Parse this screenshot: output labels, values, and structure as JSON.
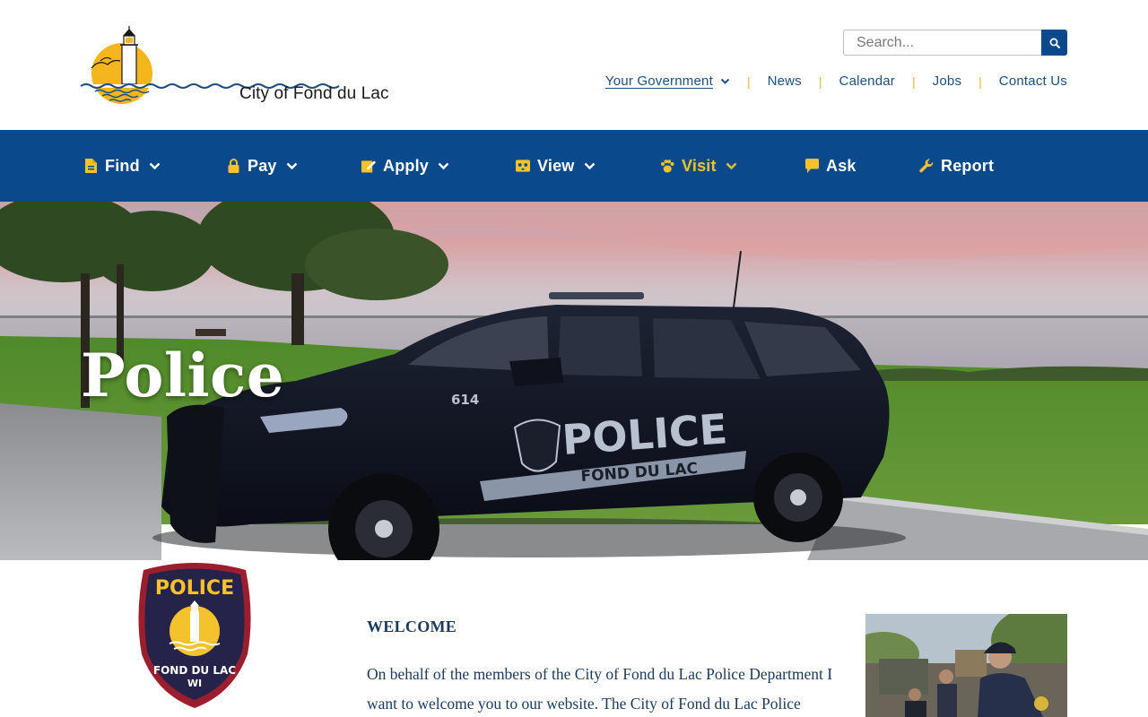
{
  "site": {
    "logo_text": "City of Fond du Lac"
  },
  "search": {
    "placeholder": "Search..."
  },
  "utility_nav": {
    "items": [
      {
        "label": "Your Government",
        "has_dropdown": true
      },
      {
        "label": "News"
      },
      {
        "label": "Calendar"
      },
      {
        "label": "Jobs"
      },
      {
        "label": "Contact Us"
      }
    ]
  },
  "main_nav": {
    "items": [
      {
        "label": "Find",
        "icon": "document-icon",
        "has_dropdown": true
      },
      {
        "label": "Pay",
        "icon": "lock-icon",
        "has_dropdown": true
      },
      {
        "label": "Apply",
        "icon": "edit-icon",
        "has_dropdown": true
      },
      {
        "label": "View",
        "icon": "viewer-icon",
        "has_dropdown": true
      },
      {
        "label": "Visit",
        "icon": "paw-icon",
        "has_dropdown": true,
        "active": true
      },
      {
        "label": "Ask",
        "icon": "speech-bubble-icon",
        "has_dropdown": false
      },
      {
        "label": "Report",
        "icon": "wrench-icon",
        "has_dropdown": false
      }
    ]
  },
  "hero": {
    "title": "Police",
    "car_number": "614",
    "car_text_main": "POLICE",
    "car_text_sub": "FOND DU LAC"
  },
  "badge": {
    "top_text": "POLICE",
    "bottom_text": "FOND DU LAC",
    "state": "WI"
  },
  "welcome": {
    "heading": "WELCOME",
    "body": "On behalf of the members of the City of Fond du Lac Police Department I want to welcome you to our website. The City of Fond du Lac Police"
  },
  "colors": {
    "nav_blue": "#0a4a8c",
    "accent_gold": "#f3c22d",
    "text_navy": "#1c3a5e",
    "link_blue": "#1c4f82"
  }
}
